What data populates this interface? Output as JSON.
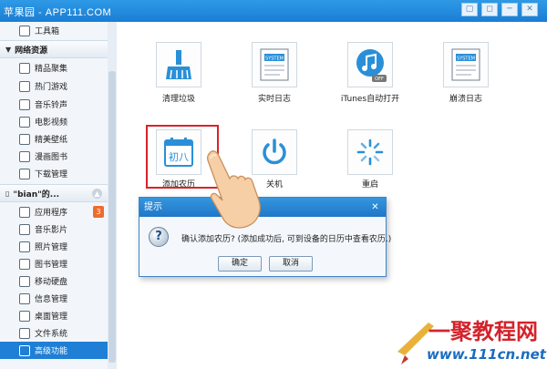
{
  "watermark_top": "苹果园 - APP111.COM",
  "window_controls": [
    "▢",
    "◻",
    "─",
    "✕"
  ],
  "sidebar": {
    "items": [
      {
        "label": "工具箱",
        "type": "item"
      },
      {
        "label": "网络资源",
        "type": "header"
      },
      {
        "label": "精品聚集",
        "type": "item"
      },
      {
        "label": "热门游戏",
        "type": "item"
      },
      {
        "label": "音乐铃声",
        "type": "item"
      },
      {
        "label": "电影视频",
        "type": "item"
      },
      {
        "label": "精美壁纸",
        "type": "item"
      },
      {
        "label": "漫画图书",
        "type": "item"
      },
      {
        "label": "下载管理",
        "type": "item"
      },
      {
        "label": "\"bian\"的...",
        "type": "header"
      },
      {
        "label": "应用程序",
        "type": "item",
        "badge": "3"
      },
      {
        "label": "音乐影片",
        "type": "item"
      },
      {
        "label": "照片管理",
        "type": "item"
      },
      {
        "label": "图书管理",
        "type": "item"
      },
      {
        "label": "移动硬盘",
        "type": "item"
      },
      {
        "label": "信息管理",
        "type": "item"
      },
      {
        "label": "桌面管理",
        "type": "item"
      },
      {
        "label": "文件系统",
        "type": "item"
      },
      {
        "label": "高级功能",
        "type": "item",
        "selected": true
      }
    ]
  },
  "tiles": [
    {
      "label": "清理垃圾",
      "icon": "broom-icon"
    },
    {
      "label": "实时日志",
      "icon": "system-log-icon",
      "icon_text": "SYSTEM"
    },
    {
      "label": "iTunes自动打开",
      "icon": "itunes-icon",
      "icon_badge": "OFF"
    },
    {
      "label": "崩溃日志",
      "icon": "crash-log-icon",
      "icon_text": "SYSTEM"
    },
    {
      "label": "添加农历",
      "icon": "calendar-icon",
      "icon_text": "初八"
    },
    {
      "label": "关机",
      "icon": "power-icon"
    },
    {
      "label": "重启",
      "icon": "restart-icon"
    }
  ],
  "dialog": {
    "title": "提示",
    "message": "确认添加农历? (添加成功后, 可到设备的日历中查看农历.)",
    "ok_label": "确定",
    "cancel_label": "取消"
  },
  "brand": {
    "name": "一聚教程网",
    "url": "www.111cn.net"
  },
  "colors": {
    "accent": "#1f7fd6",
    "highlight": "#d9232b",
    "badge": "#ee6b2e"
  }
}
